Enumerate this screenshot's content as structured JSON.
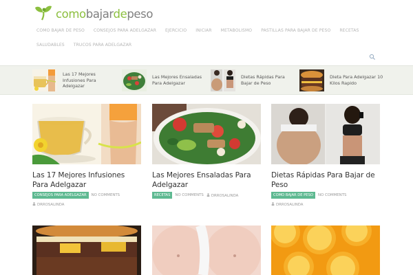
{
  "logo": {
    "part1": "como",
    "part2": "bajar",
    "part3": "de",
    "part4": "peso",
    "icon": "leaf-person-icon"
  },
  "nav": {
    "row1": [
      "COMO BAJAR DE PESO",
      "CONSEJOS PARA ADELGAZAR",
      "EJERCICIO",
      "INICIAR",
      "METABOLISMO",
      "PASTILLAS PARA BAJAR DE PESO",
      "RECETAS"
    ],
    "row2": [
      "SALUDABLES",
      "TRUCOS PARA ADELGAZAR"
    ],
    "search_icon": "search-icon"
  },
  "strip": [
    {
      "title": "Las 17 Mejores Infusiones Para Adelgazar"
    },
    {
      "title": "Las Mejores Ensaladas Para Adelgazar"
    },
    {
      "title": "Dietas Rápidas Para Bajar de Peso"
    },
    {
      "title": "Dieta Para Adelgazar 10 Kilos Rapido"
    }
  ],
  "cards": [
    {
      "title": "Las 17 Mejores Infusiones Para Adelgazar",
      "category": "CONSEJOS PARA ADELGAZAR",
      "comments": "NO COMMENTS",
      "author": "DRROSALINDA"
    },
    {
      "title": "Las Mejores Ensaladas Para Adelgazar",
      "category": "RECETAS",
      "comments": "NO COMMENTS",
      "author": "DRROSALINDA"
    },
    {
      "title": "Dietas Rápidas Para Bajar de Peso",
      "category": "COMO BAJAR DE PESO",
      "comments": "NO COMMENTS",
      "author": "DRROSALINDA"
    }
  ],
  "colors": {
    "brand_green": "#8cbf3f",
    "badge_green": "#5eb991",
    "strip_bg": "#f0f2ec"
  }
}
